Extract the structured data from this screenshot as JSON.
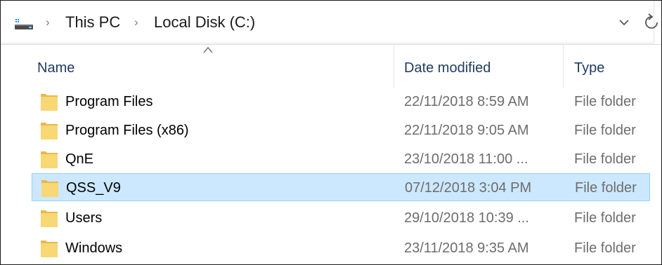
{
  "address_bar": {
    "crumbs": [
      "This PC",
      "Local Disk (C:)"
    ]
  },
  "columns": {
    "name": "Name",
    "date_modified": "Date modified",
    "type": "Type"
  },
  "files": [
    {
      "name": "Program Files",
      "date": "22/11/2018 8:59 AM",
      "type": "File folder",
      "selected": false
    },
    {
      "name": "Program Files (x86)",
      "date": "22/11/2018 9:05 AM",
      "type": "File folder",
      "selected": false
    },
    {
      "name": "QnE",
      "date": "23/10/2018 11:00 ...",
      "type": "File folder",
      "selected": false
    },
    {
      "name": "QSS_V9",
      "date": "07/12/2018 3:04 PM",
      "type": "File folder",
      "selected": true
    },
    {
      "name": "Users",
      "date": "29/10/2018 10:39 ...",
      "type": "File folder",
      "selected": false
    },
    {
      "name": "Windows",
      "date": "23/11/2018 9:35 AM",
      "type": "File folder",
      "selected": false
    }
  ],
  "colors": {
    "selection_bg": "#cce8ff",
    "selection_border": "#99d1ff",
    "folder": "#f8d775",
    "header_text": "#1f3a5f"
  },
  "icons": {
    "location": "this-pc-icon",
    "sort": "sort-ascending-icon",
    "folder": "folder-icon",
    "dropdown": "chevron-down-icon",
    "refresh": "refresh-icon"
  }
}
